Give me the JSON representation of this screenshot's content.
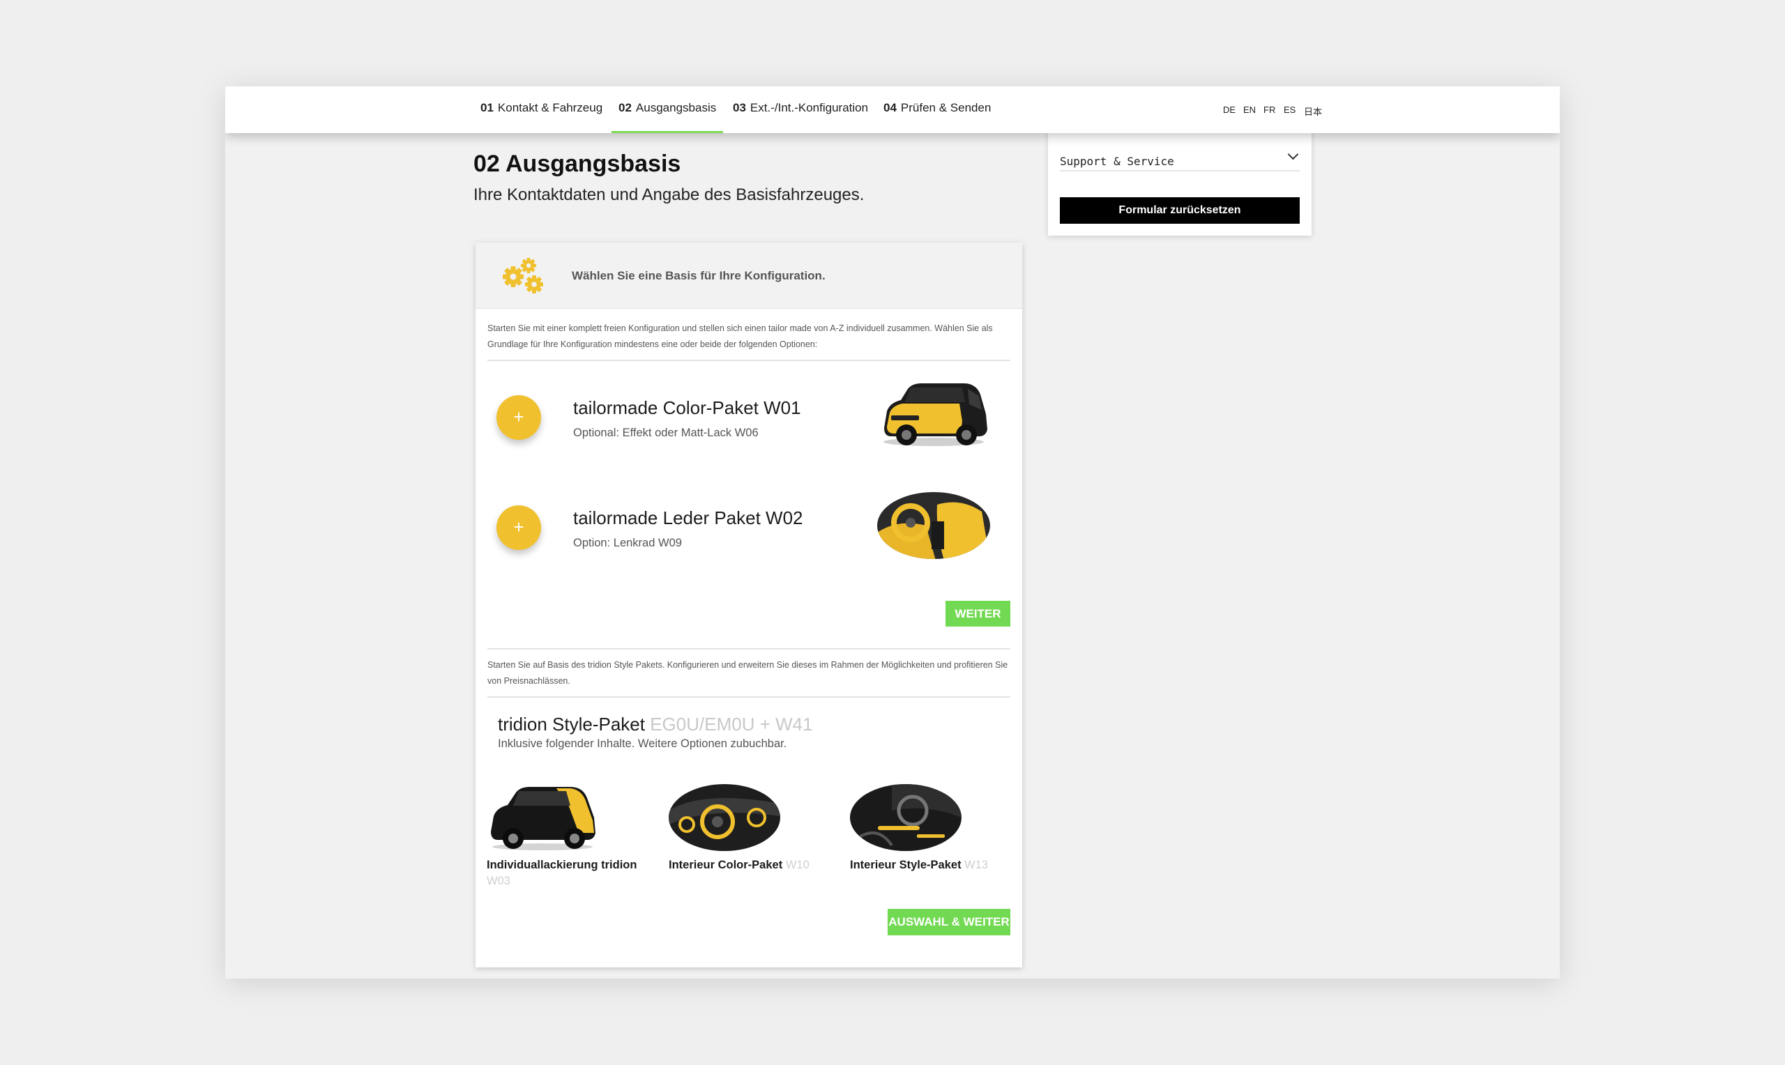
{
  "nav": {
    "steps": [
      {
        "num": "01",
        "label": "Kontakt & Fahrzeug"
      },
      {
        "num": "02",
        "label": "Ausgangsbasis"
      },
      {
        "num": "03",
        "label": "Ext.-/Int.-Konfiguration"
      },
      {
        "num": "04",
        "label": "Prüfen & Senden"
      }
    ],
    "active_index": 1,
    "languages": [
      "DE",
      "EN",
      "FR",
      "ES",
      "日本"
    ],
    "accent_color": "#7ed957"
  },
  "page": {
    "title": "02 Ausgangsbasis",
    "subtitle": "Ihre Kontaktdaten und Angabe des Basisfahrzeuges."
  },
  "side": {
    "support_label": "Support & Service",
    "reset_label": "Formular zurücksetzen"
  },
  "card": {
    "icon": "gears-icon",
    "header": "Wählen Sie eine Basis für Ihre Konfiguration.",
    "intro1": "Starten Sie mit einer komplett freien Konfiguration und stellen sich einen tailor made von A-Z individuell zusammen. Wählen Sie als Grundlage für Ihre Konfiguration mindestens eine oder beide der folgenden Optionen:",
    "options": [
      {
        "title": "tailormade Color-Paket W01",
        "subtitle": "Optional: Effekt oder Matt-Lack W06",
        "image": "yellow-car-image"
      },
      {
        "title": "tailormade Leder Paket W02",
        "subtitle": "Option: Lenkrad W09",
        "image": "yellow-interior-image"
      }
    ],
    "weiter_label": "WEITER",
    "intro2": "Starten Sie auf Basis des tridion Style Pakets. Konfigurieren und erweitern Sie dieses im Rahmen der Möglichkeiten und profitieren Sie von Preisnachlässen.",
    "tridion": {
      "title": "tridion Style-Paket",
      "code": "EG0U/EM0U + W41",
      "subtitle": "Inklusive folgender Inhalte. Weitere Optionen zubuchbar."
    },
    "packages": [
      {
        "name": "Individuallackierung tridion",
        "code": "W03"
      },
      {
        "name": "Interieur Color-Paket",
        "code": "W10"
      },
      {
        "name": "Interieur Style-Paket",
        "code": "W13"
      }
    ],
    "auswahl_label": "AUSWAHL & WEITER",
    "brand_yellow": "#f0c02e",
    "button_green": "#72d952"
  }
}
